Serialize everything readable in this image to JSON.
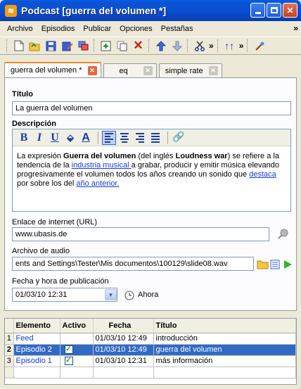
{
  "window": {
    "title": "Podcast [guerra del volumen *]"
  },
  "menu": {
    "items": [
      "Archivo",
      "Episodios",
      "Publicar",
      "Opciones",
      "Pestañas"
    ],
    "more": "»"
  },
  "tabs": [
    {
      "label": "guerra del volumen *",
      "active": true
    },
    {
      "label": "eq",
      "active": false
    },
    {
      "label": "simple rate",
      "active": false
    }
  ],
  "form": {
    "title_label": "Título",
    "title_value": "La guerra del volumen",
    "description_label": "Descripción",
    "description": {
      "p1": "La expresión ",
      "b1": "Guerra del volumen",
      "p2": " (del inglés ",
      "b2": "Loudness war",
      "p3": ") se refiere a la tendencia de la ",
      "l1": "industria musical ",
      "p4": "a grabar, producir y emitir música elevando progresivamente el volumen todos los años creando un sonido que ",
      "l2": "destaca",
      "p5": " por sobre los del ",
      "l3": "año anterior."
    },
    "url_label": "Enlace de internet (URL)",
    "url_value": "www.ubasis.de",
    "audio_label": "Archivo de audio",
    "audio_value": "ents and Settings\\Tester\\Mis documentos\\100129\\slide08.wav",
    "date_label": "Fecha y hora de publicación",
    "date_value": "01/03/10 12:31",
    "now_label": "Ahora"
  },
  "table": {
    "headers": [
      "Elemento",
      "Activo",
      "Fecha",
      "Título"
    ],
    "rows": [
      {
        "num": "1",
        "element": "Feed",
        "active": false,
        "date": "01/03/10 12:49",
        "title": "introducción",
        "selected": false
      },
      {
        "num": "2",
        "element": "Episodio 2",
        "active": true,
        "date": "01/03/10 12:49",
        "title": "guerra del volumen",
        "selected": true
      },
      {
        "num": "3",
        "element": "Episodio 1",
        "active": true,
        "date": "01/03/10 12:31",
        "title": "más información",
        "selected": false
      }
    ]
  }
}
